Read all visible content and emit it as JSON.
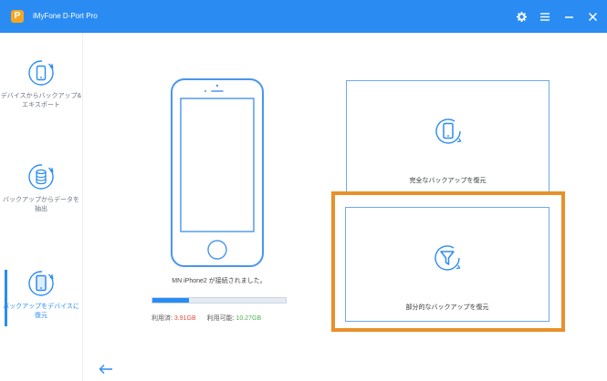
{
  "app": {
    "logo_letter": "P",
    "title": "iMyFone D-Port Pro",
    "controls": [
      "gear-icon",
      "menu-icon",
      "minimize-icon",
      "close-icon"
    ]
  },
  "sidebar": {
    "items": [
      {
        "label": "デバイスからバックアップ&エキスポート",
        "icon": "phone-sync-icon",
        "active": false
      },
      {
        "label": "バックアップからデータを抽出",
        "icon": "database-sync-icon",
        "active": false
      },
      {
        "label": "バックアップをデバイスに復元",
        "icon": "phone-restore-icon",
        "active": true
      }
    ]
  },
  "device": {
    "connected_text": "MN iPhone2 が接続されました。",
    "used_label": "利用済:",
    "used_value": "3.91GB",
    "available_label": "利用可能:",
    "available_value": "10.27GB",
    "used_fraction": 0.276
  },
  "options": {
    "full_restore": "完全なバックアップを復元",
    "partial_restore": "部分的なバックアップを復元"
  },
  "colors": {
    "accent": "#2a8cf3",
    "highlight": "#e8902a",
    "used": "#e24b3b",
    "available": "#4db34a"
  }
}
